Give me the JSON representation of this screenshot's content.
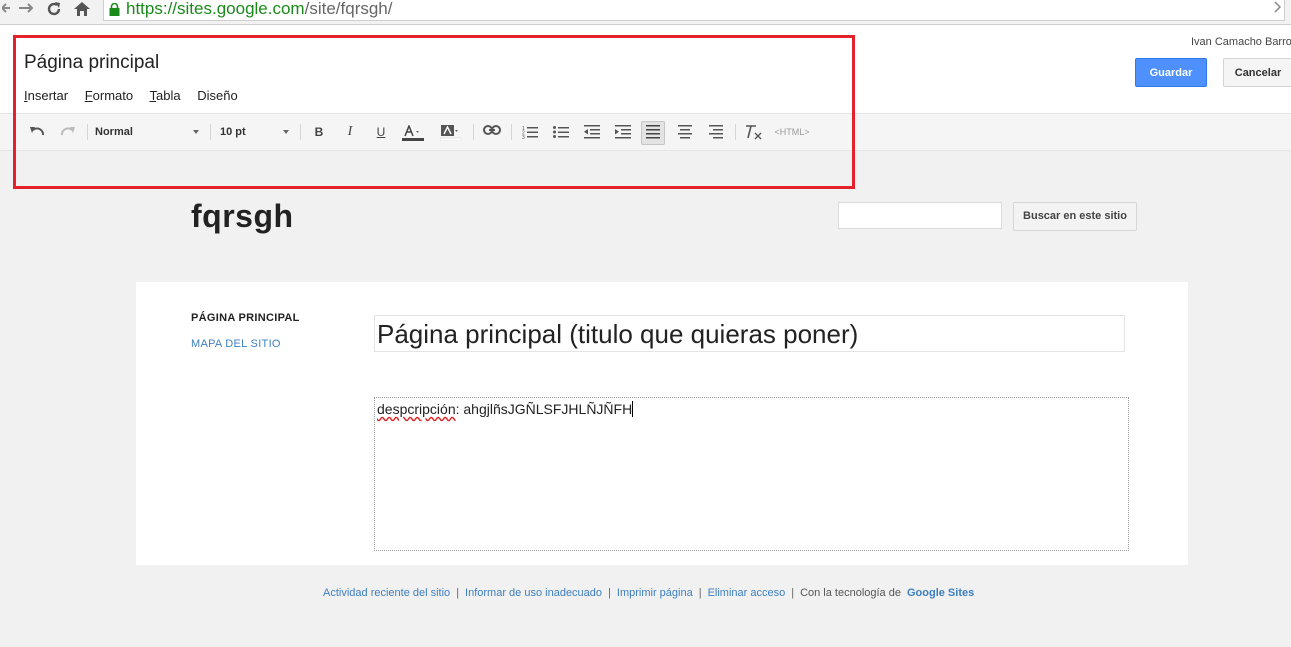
{
  "browser": {
    "url_scheme": "https://",
    "url_host": "sites.google.com",
    "url_path": "/site/fqrsgh/"
  },
  "editor": {
    "page_title": "Página principal",
    "menus": [
      {
        "first": "I",
        "rest": "nsertar"
      },
      {
        "first": "F",
        "rest": "ormato"
      },
      {
        "first": "T",
        "rest": "abla"
      },
      {
        "first": "",
        "rest": "Diseño"
      }
    ],
    "user_name": "Ivan Camacho Barros",
    "save_label": "Guardar",
    "cancel_label": "Cancelar"
  },
  "toolbar": {
    "style_value": "Normal",
    "size_value": "10 pt",
    "bold_glyph": "B",
    "italic_glyph": "I",
    "underline_glyph": "U",
    "html_label": "<HTML>",
    "active_alignment": "left"
  },
  "site": {
    "title": "fqrsgh",
    "search_value": "",
    "search_button": "Buscar en este sitio"
  },
  "sidebar": {
    "current": "PÁGINA PRINCIPAL",
    "link": "MAPA DEL SITIO"
  },
  "page": {
    "title_input": "Página principal (titulo que quieras poner)",
    "body_misspelled": "despcripción",
    "body_rest": ": ahgjlñsJGÑLSFJHLÑJÑFH"
  },
  "footer": {
    "links": [
      "Actividad reciente del sitio",
      "Informar de uso inadecuado",
      "Imprimir página",
      "Eliminar acceso"
    ],
    "powered_prefix": "Con la tecnología de",
    "powered_brand": "Google Sites"
  },
  "colors": {
    "accent_blue": "#4d90fe",
    "highlight_red": "#e4222b",
    "link_blue": "#3d7fc1"
  }
}
